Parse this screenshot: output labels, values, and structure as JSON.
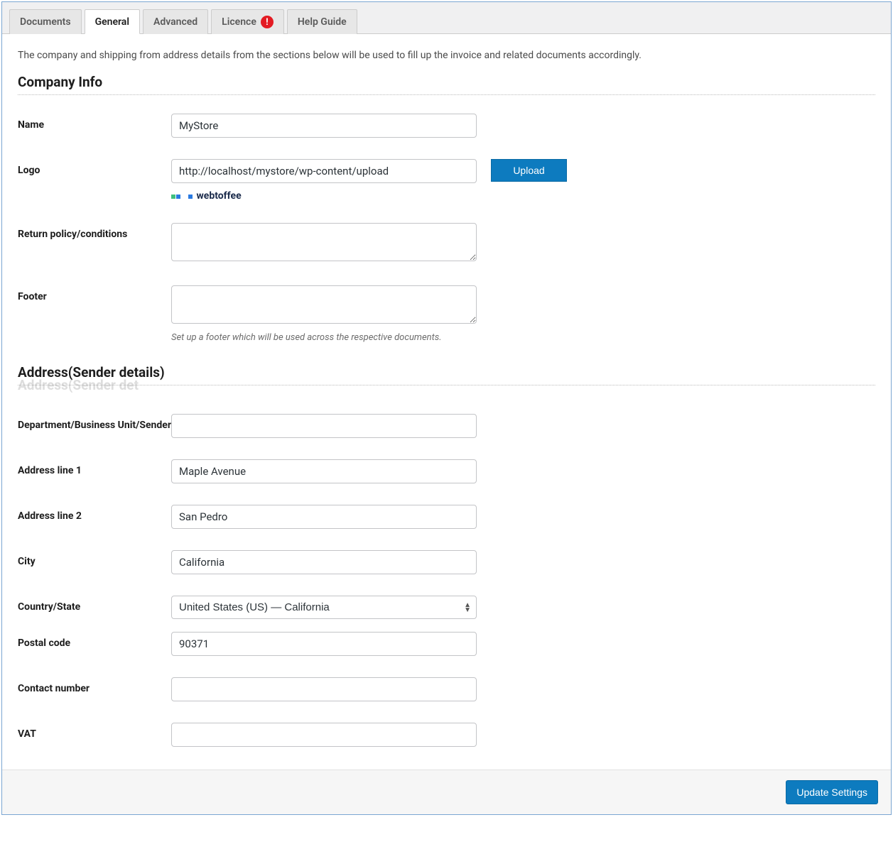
{
  "tabs": {
    "documents": "Documents",
    "general": "General",
    "advanced": "Advanced",
    "licence": "Licence",
    "help": "Help Guide"
  },
  "description": "The company and shipping from address details from the sections below will be used to fill up the invoice and related documents accordingly.",
  "sections": {
    "company": "Company Info",
    "address": "Address(Sender details)"
  },
  "labels": {
    "name": "Name",
    "logo": "Logo",
    "upload": "Upload",
    "return_policy": "Return policy/conditions",
    "footer": "Footer",
    "footer_help": "Set up a footer which will be used across the respective documents.",
    "dept": "Department/Business Unit/Sender",
    "addr1": "Address line 1",
    "addr2": "Address line 2",
    "city": "City",
    "country_state": "Country/State",
    "postal": "Postal code",
    "contact": "Contact number",
    "vat": "VAT",
    "submit": "Update Settings",
    "logo_brand": "webtoffee"
  },
  "values": {
    "name": "MyStore",
    "logo_url": "http://localhost/mystore/wp-content/upload",
    "return_policy": "",
    "footer": "",
    "dept": "",
    "addr1": "Maple Avenue",
    "addr2": "San Pedro",
    "city": "California",
    "country_state": "United States (US) — California",
    "postal": "90371",
    "contact": "",
    "vat": ""
  }
}
